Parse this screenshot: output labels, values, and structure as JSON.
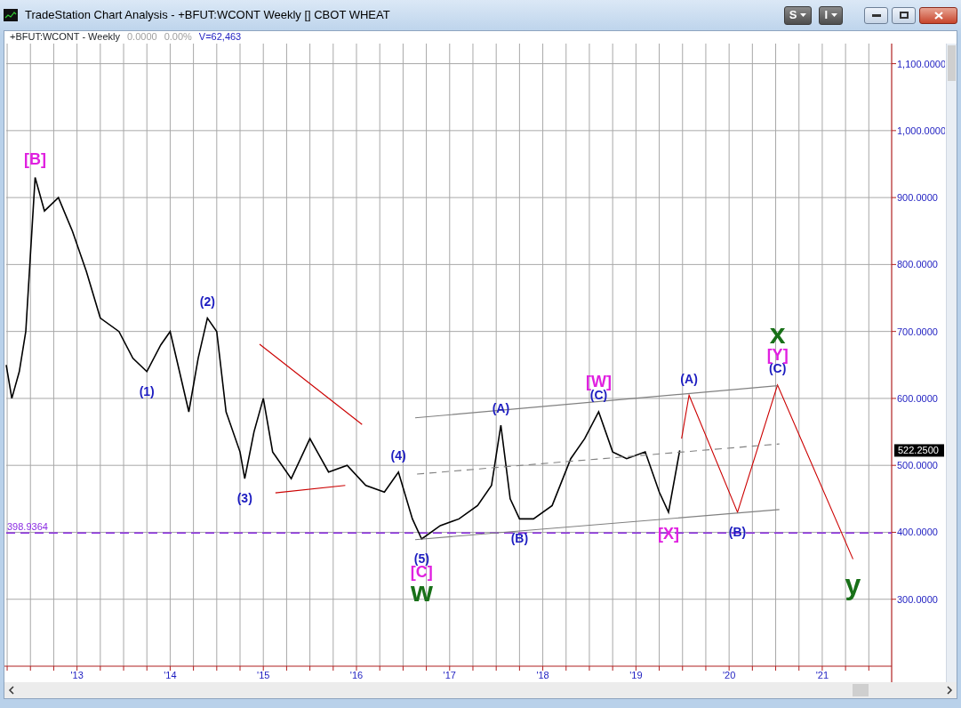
{
  "window": {
    "title": "TradeStation Chart Analysis - +BFUT:WCONT Weekly [] CBOT WHEAT"
  },
  "toolbar_buttons": [
    {
      "label": "S"
    },
    {
      "label": "I"
    }
  ],
  "header": {
    "symbol": "+BFUT:WCONT - Weekly",
    "change": "0.0000",
    "change_percent": "0.00%",
    "volume": "V=62,463"
  },
  "chart": {
    "last_price": "522.2500",
    "chart_data": {
      "type": "line",
      "grid": true,
      "xlim": [
        2012.24,
        2021.745
      ],
      "ylim": [
        200,
        1130
      ],
      "xticks": [
        {
          "value": 2013,
          "label": "'13"
        },
        {
          "value": 2014,
          "label": "'14"
        },
        {
          "value": 2015,
          "label": "'15"
        },
        {
          "value": 2016,
          "label": "'16"
        },
        {
          "value": 2017,
          "label": "'17"
        },
        {
          "value": 2018,
          "label": "'18"
        },
        {
          "value": 2019,
          "label": "'19"
        },
        {
          "value": 2020,
          "label": "'20"
        },
        {
          "value": 2021,
          "label": "'21"
        }
      ],
      "yticks": [
        {
          "value": 300,
          "label": "300.0000"
        },
        {
          "value": 400,
          "label": "400.0000"
        },
        {
          "value": 500,
          "label": "500.0000"
        },
        {
          "value": 600,
          "label": "600.0000"
        },
        {
          "value": 700,
          "label": "700.0000"
        },
        {
          "value": 800,
          "label": "800.0000"
        },
        {
          "value": 900,
          "label": "900.0000"
        },
        {
          "value": 1000,
          "label": "1,000.0000"
        },
        {
          "value": 1100,
          "label": "1,100.0000"
        }
      ],
      "x": [
        2012.24,
        2012.3,
        2012.38,
        2012.45,
        2012.55,
        2012.65,
        2012.8,
        2012.95,
        2013.1,
        2013.25,
        2013.45,
        2013.6,
        2013.75,
        2013.9,
        2014.0,
        2014.1,
        2014.2,
        2014.3,
        2014.4,
        2014.5,
        2014.6,
        2014.75,
        2014.8,
        2014.9,
        2015.0,
        2015.1,
        2015.3,
        2015.5,
        2015.7,
        2015.9,
        2016.1,
        2016.3,
        2016.45,
        2016.6,
        2016.7,
        2016.9,
        2017.1,
        2017.3,
        2017.45,
        2017.55,
        2017.65,
        2017.75,
        2017.9,
        2018.1,
        2018.3,
        2018.45,
        2018.6,
        2018.75,
        2018.9,
        2019.1,
        2019.25,
        2019.35,
        2019.47
      ],
      "series": [
        {
          "color": "#000000",
          "values": [
            650,
            600,
            640,
            700,
            930,
            880,
            900,
            850,
            790,
            720,
            700,
            660,
            640,
            680,
            700,
            640,
            580,
            660,
            720,
            700,
            580,
            520,
            480,
            550,
            600,
            520,
            480,
            540,
            490,
            500,
            470,
            460,
            490,
            420,
            390,
            410,
            420,
            440,
            470,
            560,
            450,
            420,
            420,
            440,
            510,
            540,
            580,
            520,
            510,
            520,
            460,
            430,
            522.25
          ]
        },
        {
          "color": "#cc0000",
          "x": [
            2019.49,
            2019.57,
            2020.09,
            2020.52,
            2021.33
          ],
          "values": [
            540,
            605,
            430,
            620,
            360
          ]
        },
        {
          "color": "#cc0000",
          "x": [
            2014.96,
            2016.06
          ],
          "values": [
            681,
            561
          ]
        },
        {
          "color": "#cc0000",
          "x": [
            2015.13,
            2015.88
          ],
          "values": [
            459,
            470
          ]
        },
        {
          "color": "#808080",
          "x": [
            2016.63,
            2020.52
          ],
          "values": [
            571,
            619
          ]
        },
        {
          "color": "#808080",
          "line_style": "dashed",
          "x": [
            2016.65,
            2020.54
          ],
          "values": [
            487,
            532
          ]
        },
        {
          "color": "#808080",
          "x": [
            2016.63,
            2020.54
          ],
          "values": [
            389,
            434
          ]
        }
      ],
      "ref_lines": [
        {
          "axis": "y",
          "value": 398.9364,
          "label": "398.9364",
          "color": "#8a2be2"
        }
      ],
      "annotations": [
        {
          "text": "[B]",
          "x": 2012.55,
          "y": 930
        },
        {
          "text": "(2)",
          "x": 2014.4,
          "y": 720
        },
        {
          "text": "(1)",
          "x": 2013.75,
          "y": 640
        },
        {
          "text": "(3)",
          "x": 2014.8,
          "y": 480
        },
        {
          "text": "(4)",
          "x": 2016.45,
          "y": 490
        },
        {
          "text": "(5)",
          "x": 2016.7,
          "y": 390
        },
        {
          "text": "[C]",
          "x": 2016.7,
          "y": 390
        },
        {
          "text": "w",
          "x": 2016.7,
          "y": 390
        },
        {
          "text": "(A)",
          "x": 2017.55,
          "y": 560
        },
        {
          "text": "(B)",
          "x": 2017.75,
          "y": 420
        },
        {
          "text": "(C)",
          "x": 2018.6,
          "y": 580
        },
        {
          "text": "[W]",
          "x": 2018.6,
          "y": 580
        },
        {
          "text": "[X]",
          "x": 2019.35,
          "y": 430
        },
        {
          "text": "(A)",
          "x": 2019.57,
          "y": 605
        },
        {
          "text": "(B)",
          "x": 2020.09,
          "y": 430
        },
        {
          "text": "(C)",
          "x": 2020.52,
          "y": 620
        },
        {
          "text": "[Y]",
          "x": 2020.52,
          "y": 620
        },
        {
          "text": "x",
          "x": 2020.52,
          "y": 620
        },
        {
          "text": "y",
          "x": 2021.33,
          "y": 360
        }
      ]
    },
    "wave_labels": [
      {
        "color": "#e020e0"
      },
      {
        "color": "#1c1cc0"
      },
      {
        "color": "#1c1cc0"
      },
      {
        "color": "#1c1cc0"
      },
      {
        "color": "#1c1cc0"
      },
      {
        "color": "#1c1cc0"
      },
      {
        "color": "#e020e0"
      },
      {
        "color": "#187018"
      },
      {
        "color": "#1c1cc0"
      },
      {
        "color": "#1c1cc0"
      },
      {
        "color": "#1c1cc0"
      },
      {
        "color": "#e020e0"
      },
      {
        "color": "#e020e0"
      },
      {
        "color": "#1c1cc0"
      },
      {
        "color": "#1c1cc0"
      },
      {
        "color": "#1c1cc0"
      },
      {
        "color": "#e020e0"
      },
      {
        "color": "#187018"
      },
      {
        "color": "#187018"
      }
    ]
  }
}
